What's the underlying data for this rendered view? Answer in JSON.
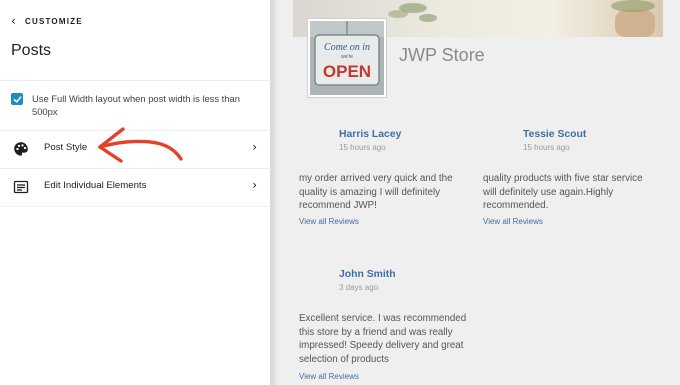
{
  "sidebar": {
    "back_label": "CUSTOMIZE",
    "title": "Posts",
    "full_width_option": {
      "label": "Use Full Width layout when post width is less than 500px",
      "checked": true
    },
    "menu_items": [
      {
        "label": "Post Style",
        "icon": "palette-icon"
      },
      {
        "label": "Edit Individual Elements",
        "icon": "elements-icon"
      }
    ],
    "accent_color": "#1e8cbe"
  },
  "preview": {
    "store_name": "JWP Store",
    "sign": {
      "top_text": "Come on in",
      "middle_text": "we're",
      "main_text": "OPEN"
    },
    "reviews": [
      {
        "author": "Harris Lacey",
        "time": "15 hours ago",
        "text": "my order arrived very quick and the quality is amazing I will definitely recommend JWP!",
        "link": "View all Reviews"
      },
      {
        "author": "Tessie Scout",
        "time": "15 hours ago",
        "text": "quality products with five star service will definitely use again.Highly recommended.",
        "link": "View all Reviews"
      },
      {
        "author": "John Smith",
        "time": "3 days ago",
        "text": "Excellent service. I was recommended this store by a friend and was really impressed! Speedy delivery and great selection of products",
        "link": "View all Reviews"
      }
    ],
    "link_color": "#3e6fa3",
    "annotation_color": "#e4412a"
  }
}
